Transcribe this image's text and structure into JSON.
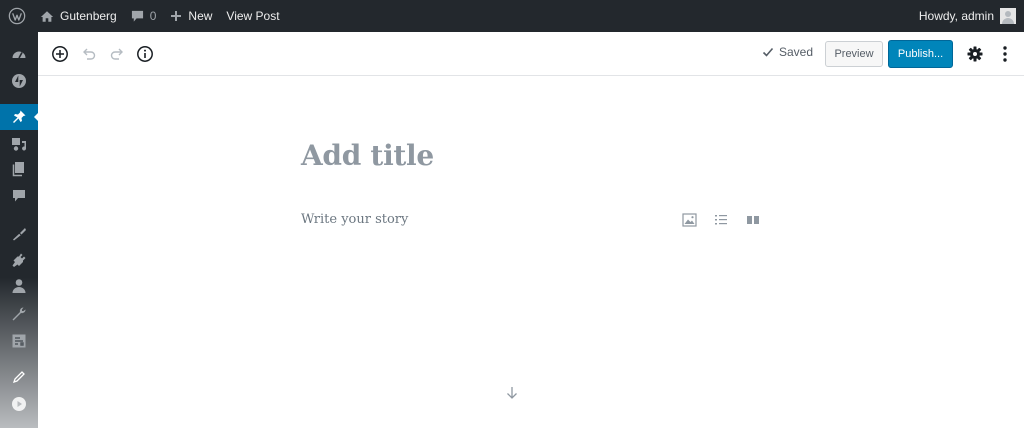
{
  "adminbar": {
    "site_name": "Gutenberg",
    "comments_count": "0",
    "new_label": "New",
    "view_post_label": "View Post",
    "greeting": "Howdy, admin"
  },
  "sidebar": {
    "items": [
      {
        "icon": "dashboard-icon"
      },
      {
        "icon": "jetpack-icon"
      },
      {
        "icon": "pin-icon",
        "active": true
      },
      {
        "icon": "media-icon"
      },
      {
        "icon": "pages-icon"
      },
      {
        "icon": "comments-icon"
      },
      {
        "icon": "appearance-icon"
      },
      {
        "icon": "plugins-icon"
      },
      {
        "icon": "users-icon"
      },
      {
        "icon": "tools-icon"
      },
      {
        "icon": "settings-icon"
      },
      {
        "icon": "gutenberg-icon"
      },
      {
        "icon": "play-icon"
      }
    ]
  },
  "toolbar": {
    "status_label": "Saved",
    "preview_label": "Preview",
    "publish_label": "Publish..."
  },
  "editor": {
    "title_placeholder": "Add title",
    "body_placeholder": "Write your story"
  },
  "colors": {
    "admin_bar": "#23282d",
    "accent": "#0073aa",
    "publish": "#0085ba"
  }
}
